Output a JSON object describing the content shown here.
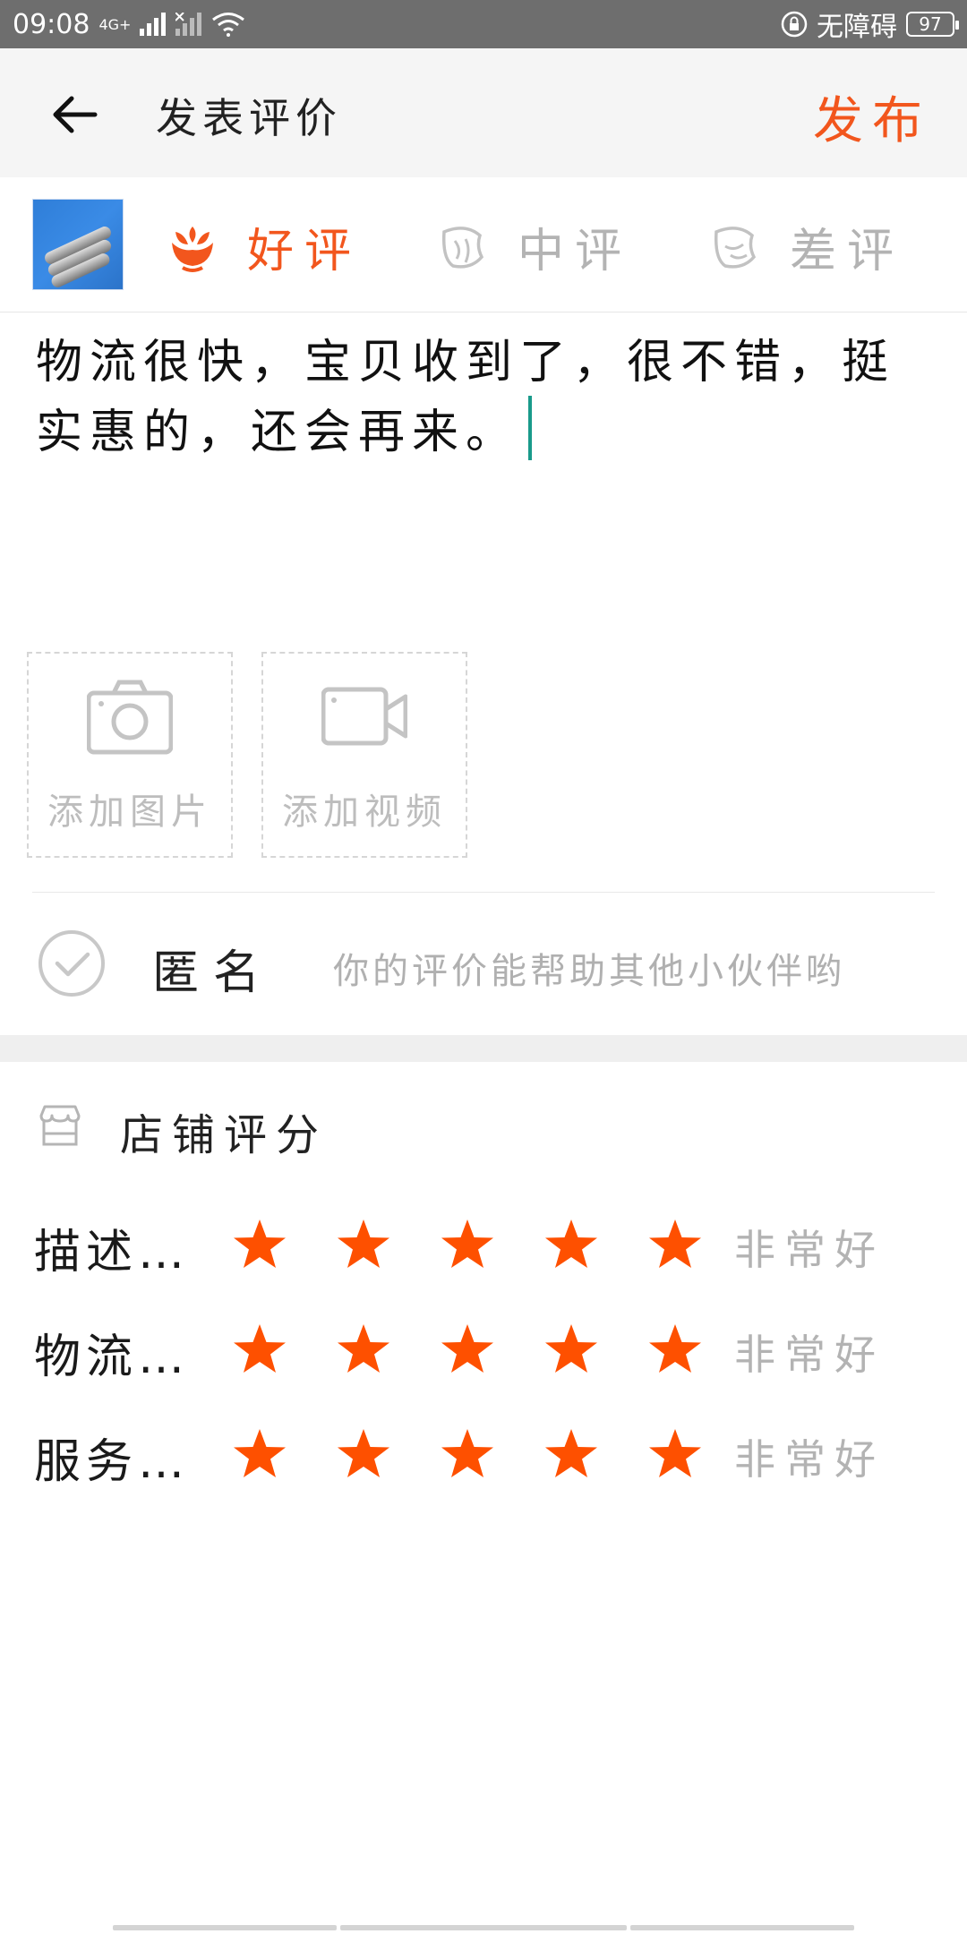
{
  "status_bar": {
    "time": "09:08",
    "network_label": "4G+",
    "accessibility_label": "无障碍",
    "battery": "97"
  },
  "header": {
    "title": "发表评价",
    "publish_label": "发布",
    "accent_color": "#f2561d"
  },
  "rating_types": {
    "good": "好评",
    "medium": "中评",
    "bad": "差评",
    "selected": "good"
  },
  "review": {
    "text": "物流很快，宝贝收到了，很不错，挺实惠的，还会再来。"
  },
  "media": {
    "add_photo_label": "添加图片",
    "add_video_label": "添加视频"
  },
  "anonymous": {
    "label": "匿名",
    "hint": "你的评价能帮助其他小伙伴哟"
  },
  "shop_rating": {
    "title": "店铺评分",
    "rows": [
      {
        "label": "描述…",
        "stars": 5,
        "max_stars": 5,
        "text": "非常好"
      },
      {
        "label": "物流…",
        "stars": 5,
        "max_stars": 5,
        "text": "非常好"
      },
      {
        "label": "服务…",
        "stars": 5,
        "max_stars": 5,
        "text": "非常好"
      }
    ]
  },
  "star_color": "#fe5000"
}
